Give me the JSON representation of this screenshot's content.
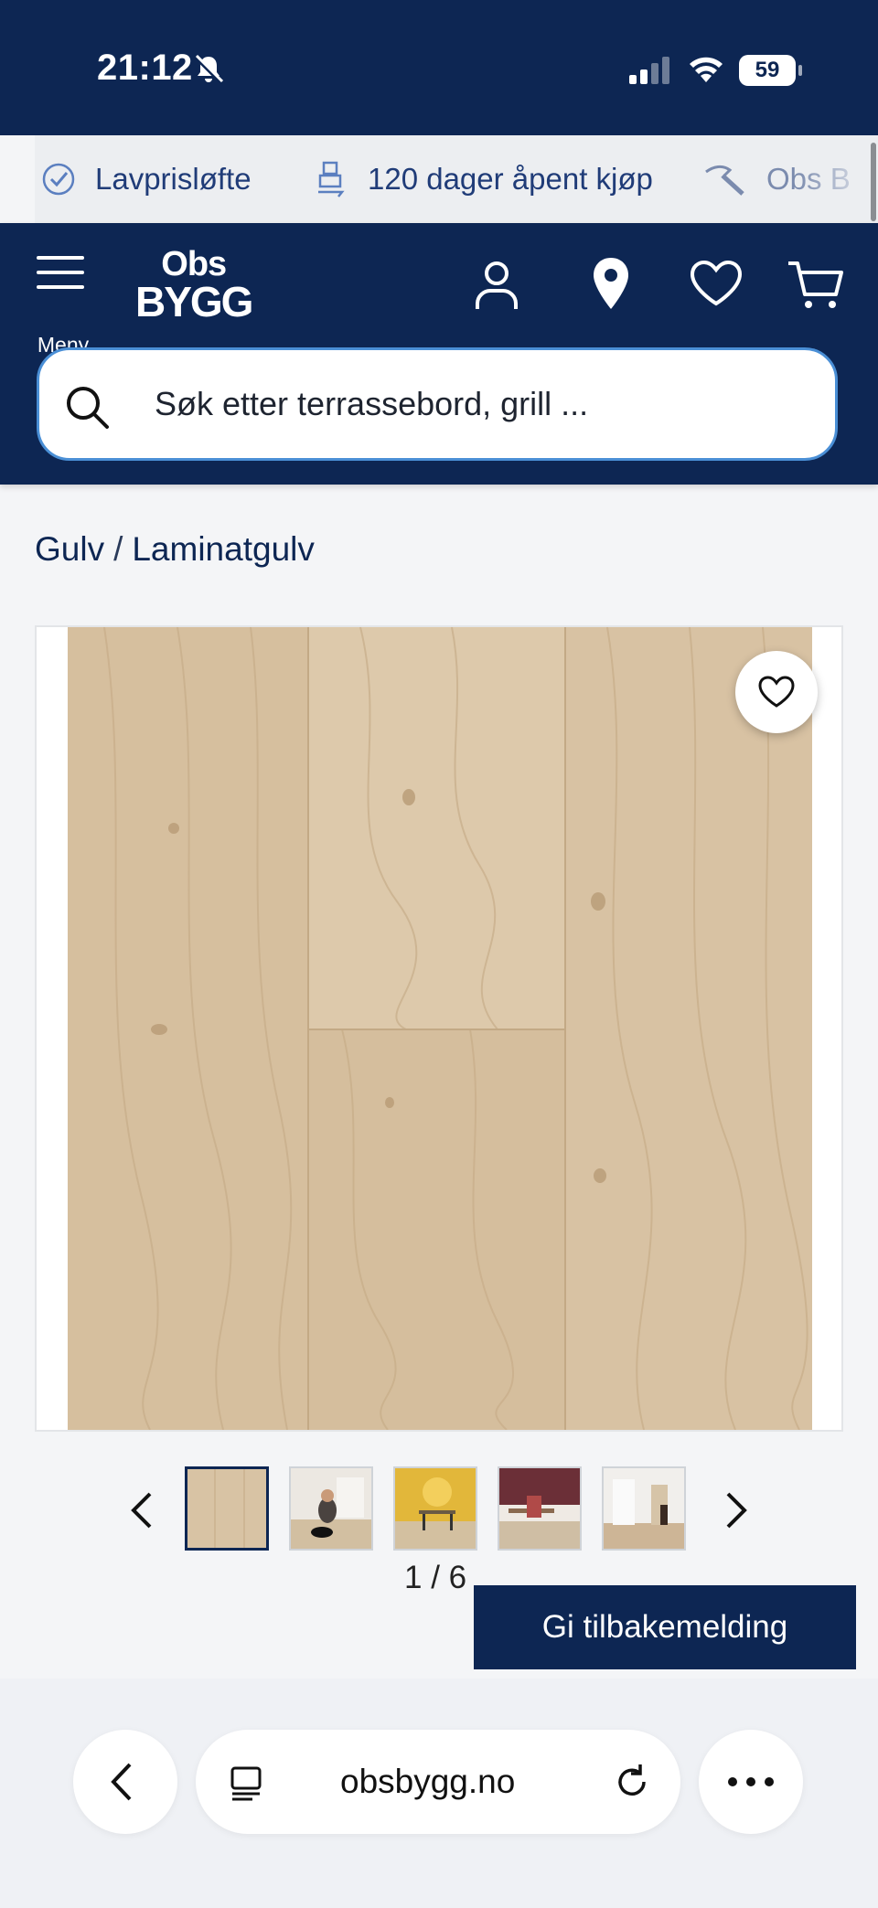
{
  "status_bar": {
    "time": "21:12",
    "battery": "59"
  },
  "usp_bar": {
    "items": [
      {
        "label": "Lavprisløfte",
        "icon": "check-badge-icon"
      },
      {
        "label": "120 dager åpent kjøp",
        "icon": "return-box-icon"
      },
      {
        "label": "Obs B",
        "icon": "hammer-icon"
      }
    ]
  },
  "header": {
    "menu_label": "Meny",
    "logo_top": "Obs",
    "logo_bottom": "BYGG",
    "search_placeholder": "Søk etter terrassebord, grill ..."
  },
  "breadcrumb": {
    "items": [
      "Gulv",
      "Laminatgulv"
    ],
    "separator": "/"
  },
  "gallery": {
    "counter": "1 / 6",
    "thumbnails": [
      "wood-floor",
      "dog-on-floor",
      "yellow-dining-room",
      "office-desk",
      "kitchen-hallway"
    ],
    "active_index": 0
  },
  "feedback_button": "Gi tilbakemelding",
  "browser": {
    "url": "obsbygg.no"
  },
  "colors": {
    "brand_navy": "#0d2653",
    "accent_blue": "#4a8fd6",
    "wood": "#d8c3a4"
  }
}
